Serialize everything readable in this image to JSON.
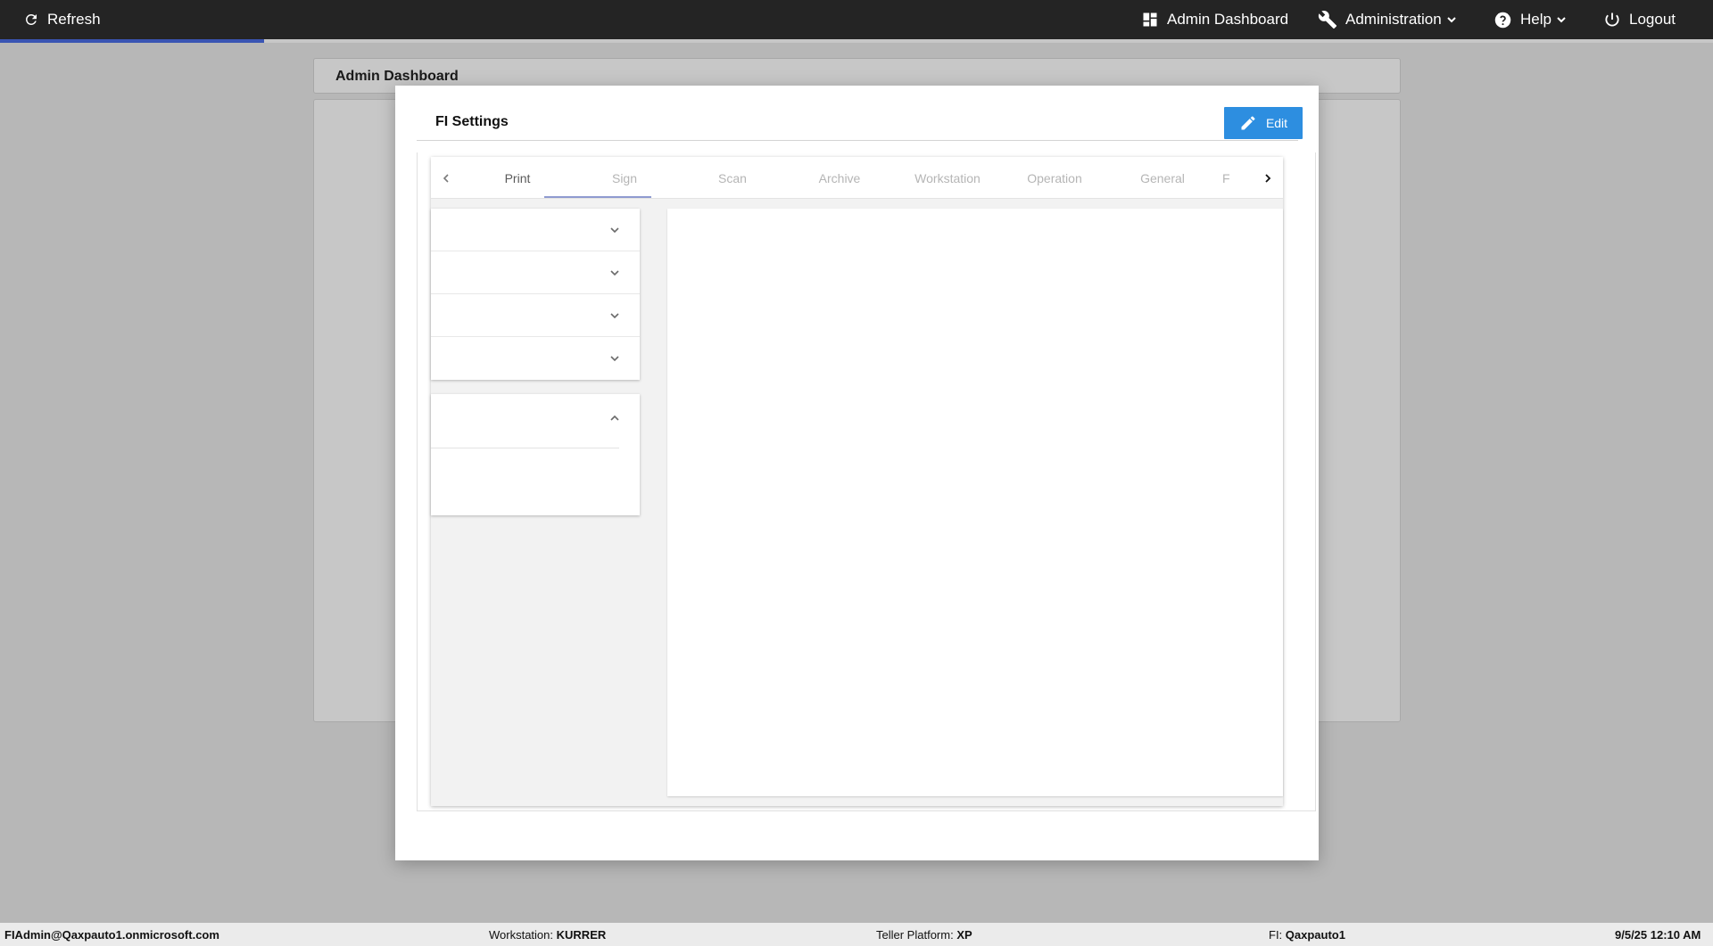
{
  "topbar": {
    "refresh_label": "Refresh",
    "admin_dashboard_label": "Admin Dashboard",
    "administration_label": "Administration",
    "help_label": "Help",
    "logout_label": "Logout",
    "loading_progress_percent": 15.4
  },
  "page": {
    "title": "Admin Dashboard"
  },
  "modal": {
    "title": "FI Settings",
    "edit_label": "Edit",
    "tabs": [
      {
        "label": "Print"
      },
      {
        "label": "Sign"
      },
      {
        "label": "Scan"
      },
      {
        "label": "Archive"
      },
      {
        "label": "Workstation"
      },
      {
        "label": "Operation"
      },
      {
        "label": "General"
      },
      {
        "label": "F"
      }
    ],
    "selected_tab": "Sign"
  },
  "statusbar": {
    "user": "FIAdmin@Qaxpauto1.onmicrosoft.com",
    "workstation_label": "Workstation:",
    "workstation_value": "KURRER",
    "platform_label": "Teller Platform:",
    "platform_value": "XP",
    "fi_label": "FI:",
    "fi_value": "Qaxpauto1",
    "datetime": "9/5/25 12:10 AM"
  },
  "colors": {
    "topbar_bg": "#242424",
    "accent_blue": "#2d8ee0",
    "progress_fill": "#3a55b3",
    "tab_underline": "#8f9bd0"
  }
}
